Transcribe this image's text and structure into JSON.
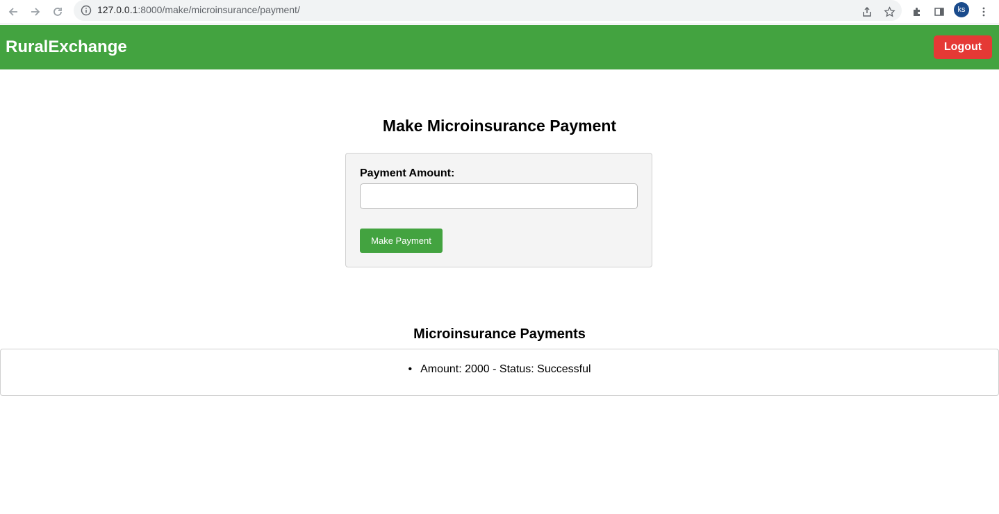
{
  "browser": {
    "url_host": "127.0.0.1",
    "url_path": ":8000/make/microinsurance/payment/",
    "profile_initials": "ks",
    "icons": [
      "back-icon",
      "forward-icon",
      "reload-icon",
      "info-icon",
      "share-icon",
      "star-icon",
      "extensions-icon",
      "side-panel-icon",
      "menu-icon"
    ]
  },
  "header": {
    "brand": "RuralExchange",
    "logout_label": "Logout",
    "colors": {
      "bar": "#43a340",
      "logout": "#e53935"
    }
  },
  "form": {
    "title": "Make Microinsurance Payment",
    "amount_label": "Payment Amount:",
    "amount_value": "",
    "submit_label": "Make Payment"
  },
  "payments": {
    "title": "Microinsurance Payments",
    "items": [
      {
        "text": "Amount: 2000 - Status: Successful"
      }
    ]
  }
}
